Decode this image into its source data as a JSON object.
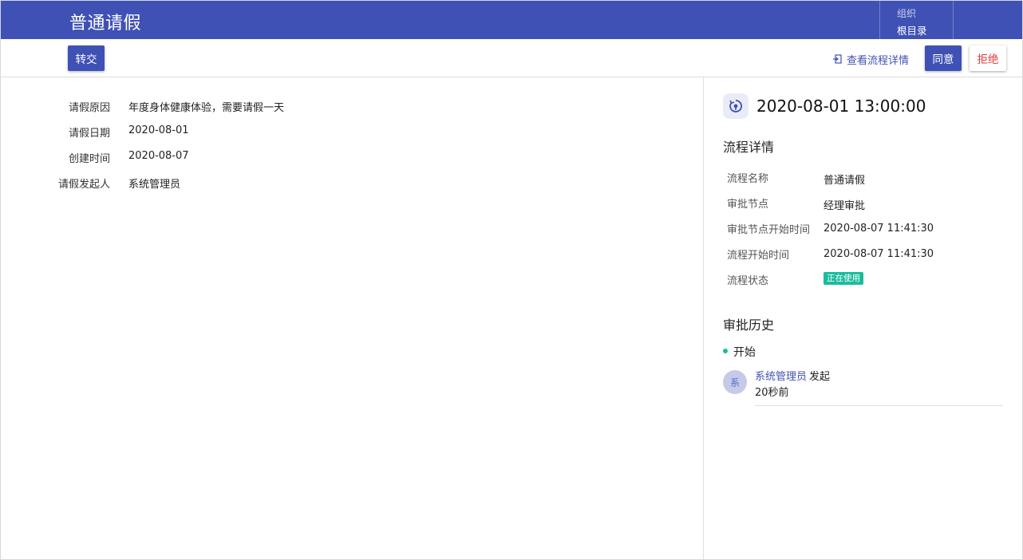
{
  "header": {
    "title": "普通请假",
    "org_label": "组织",
    "org_value": "根目录",
    "bg_color": "#3f51b5"
  },
  "toolbar": {
    "transfer_label": "转交",
    "view_process_label": "查看流程详情",
    "agree_label": "同意",
    "reject_label": "拒绝"
  },
  "form": {
    "fields": [
      {
        "label": "请假原因",
        "value": "年度身体健康体验，需要请假一天"
      },
      {
        "label": "请假日期",
        "value": "2020-08-01"
      },
      {
        "label": "创建时间",
        "value": "2020-08-07"
      },
      {
        "label": "请假发起人",
        "value": "系统管理员"
      }
    ]
  },
  "process": {
    "time": "2020-08-01 13:00:00",
    "detail_title": "流程详情",
    "details": [
      {
        "label": "流程名称",
        "value": "普通请假"
      },
      {
        "label": "审批节点",
        "value": "经理审批"
      },
      {
        "label": "审批节点开始时间",
        "value": "2020-08-07 11:41:30"
      },
      {
        "label": "流程开始时间",
        "value": "2020-08-07 11:41:30"
      }
    ],
    "status_label": "流程状态",
    "status_value": "正在使用",
    "status_color": "#1abc9c"
  },
  "history": {
    "title": "审批历史",
    "start_label": "开始",
    "entries": [
      {
        "avatar": "系",
        "user": "系统管理员",
        "action": "发起",
        "time": "20秒前"
      }
    ]
  }
}
